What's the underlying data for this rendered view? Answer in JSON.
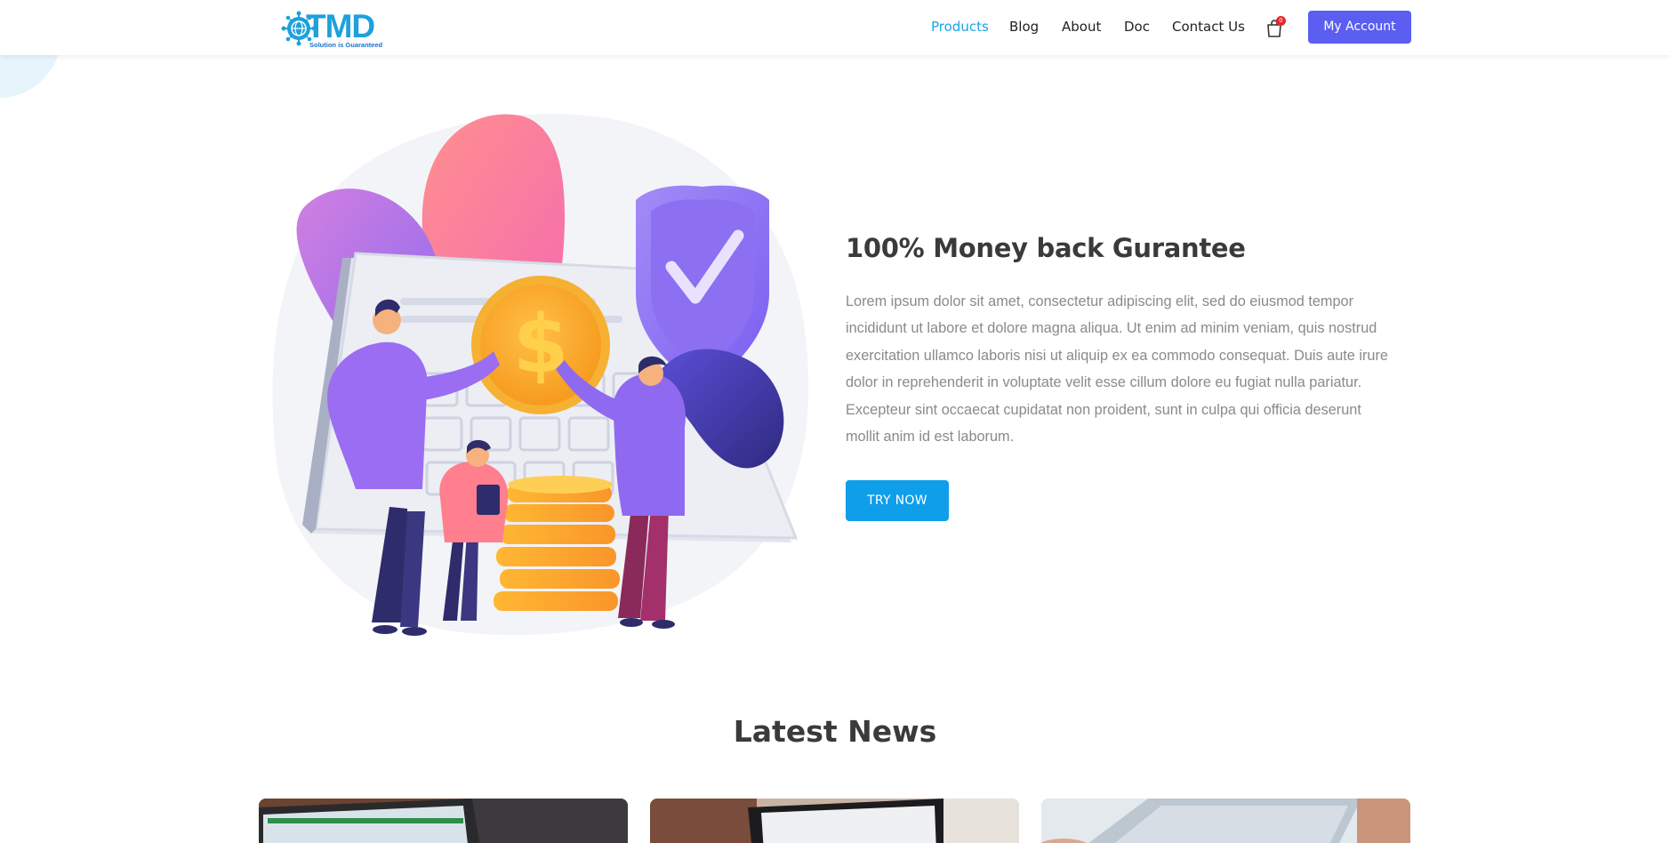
{
  "brand": {
    "logo_text": "TMD",
    "logo_tagline": "Solution is Guaranteed"
  },
  "nav": {
    "items": [
      {
        "label": "Products",
        "active": true
      },
      {
        "label": "Blog",
        "active": false
      },
      {
        "label": "About",
        "active": false
      },
      {
        "label": "Doc",
        "active": false
      },
      {
        "label": "Contact Us",
        "active": false
      }
    ],
    "cart_count": "0",
    "account_label": "My Account"
  },
  "hero": {
    "title": "100% Money back Gurantee",
    "text": "Lorem ipsum dolor sit amet, consectetur adipiscing elit, sed do eiusmod tempor incididunt ut labore et dolore magna aliqua. Ut enim ad minim veniam, quis nostrud exercitation ullamco laboris nisi ut aliquip ex ea commodo consequat. Duis aute irure dolor in reprehenderit in voluptate velit esse cillum dolore eu fugiat nulla pariatur. Excepteur sint occaecat cupidatat non proident, sunt in culpa qui officia deserunt mollit anim id est laborum.",
    "cta_label": "TRY NOW"
  },
  "news": {
    "title": "Latest News"
  },
  "colors": {
    "primary_blue": "#0f9eea",
    "nav_active": "#1aa3e6",
    "account_button": "#5b5ef0",
    "badge_red": "#e8262c"
  },
  "icons": {
    "cart": "shopping-bag-icon",
    "shield": "shield-check-icon",
    "coin": "dollar-coin-icon"
  }
}
